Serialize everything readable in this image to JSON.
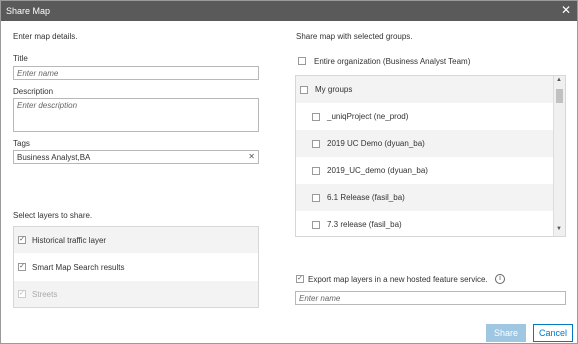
{
  "dialog": {
    "title": "Share Map",
    "close_glyph": "✕"
  },
  "details": {
    "heading": "Enter map details.",
    "title_label": "Title",
    "title_placeholder": "Enter name",
    "description_label": "Description",
    "description_placeholder": "Enter description",
    "tags_label": "Tags",
    "tags_value": "Business Analyst,BA",
    "clear_glyph": "✕"
  },
  "layers": {
    "heading": "Select layers to share.",
    "items": [
      {
        "label": "Historical traffic layer",
        "checked": true,
        "disabled": false
      },
      {
        "label": "Smart Map Search results",
        "checked": true,
        "disabled": false
      },
      {
        "label": "Streets",
        "checked": true,
        "disabled": true
      }
    ]
  },
  "groups": {
    "heading": "Share map with selected groups.",
    "org_label": "Entire organization (Business Analyst Team)",
    "items": [
      {
        "label": "My groups",
        "level": 0
      },
      {
        "label": "_uniqProject (ne_prod)",
        "level": 1
      },
      {
        "label": "2019 UC Demo (dyuan_ba)",
        "level": 1
      },
      {
        "label": "2019_UC_demo (dyuan_ba)",
        "level": 1
      },
      {
        "label": "6.1 Release (fasil_ba)",
        "level": 1
      },
      {
        "label": "7.3 release (fasil_ba)",
        "level": 1
      }
    ]
  },
  "export": {
    "label": "Export map layers in a new hosted feature service.",
    "checked": true,
    "info_glyph": "i",
    "placeholder": "Enter name"
  },
  "buttons": {
    "share": "Share",
    "cancel": "Cancel"
  },
  "colors": {
    "accent": "#0079c1",
    "share_disabled": "#9fc7e2",
    "titlebar": "#5a5a5a",
    "row_alt": "#f3f3f3"
  }
}
